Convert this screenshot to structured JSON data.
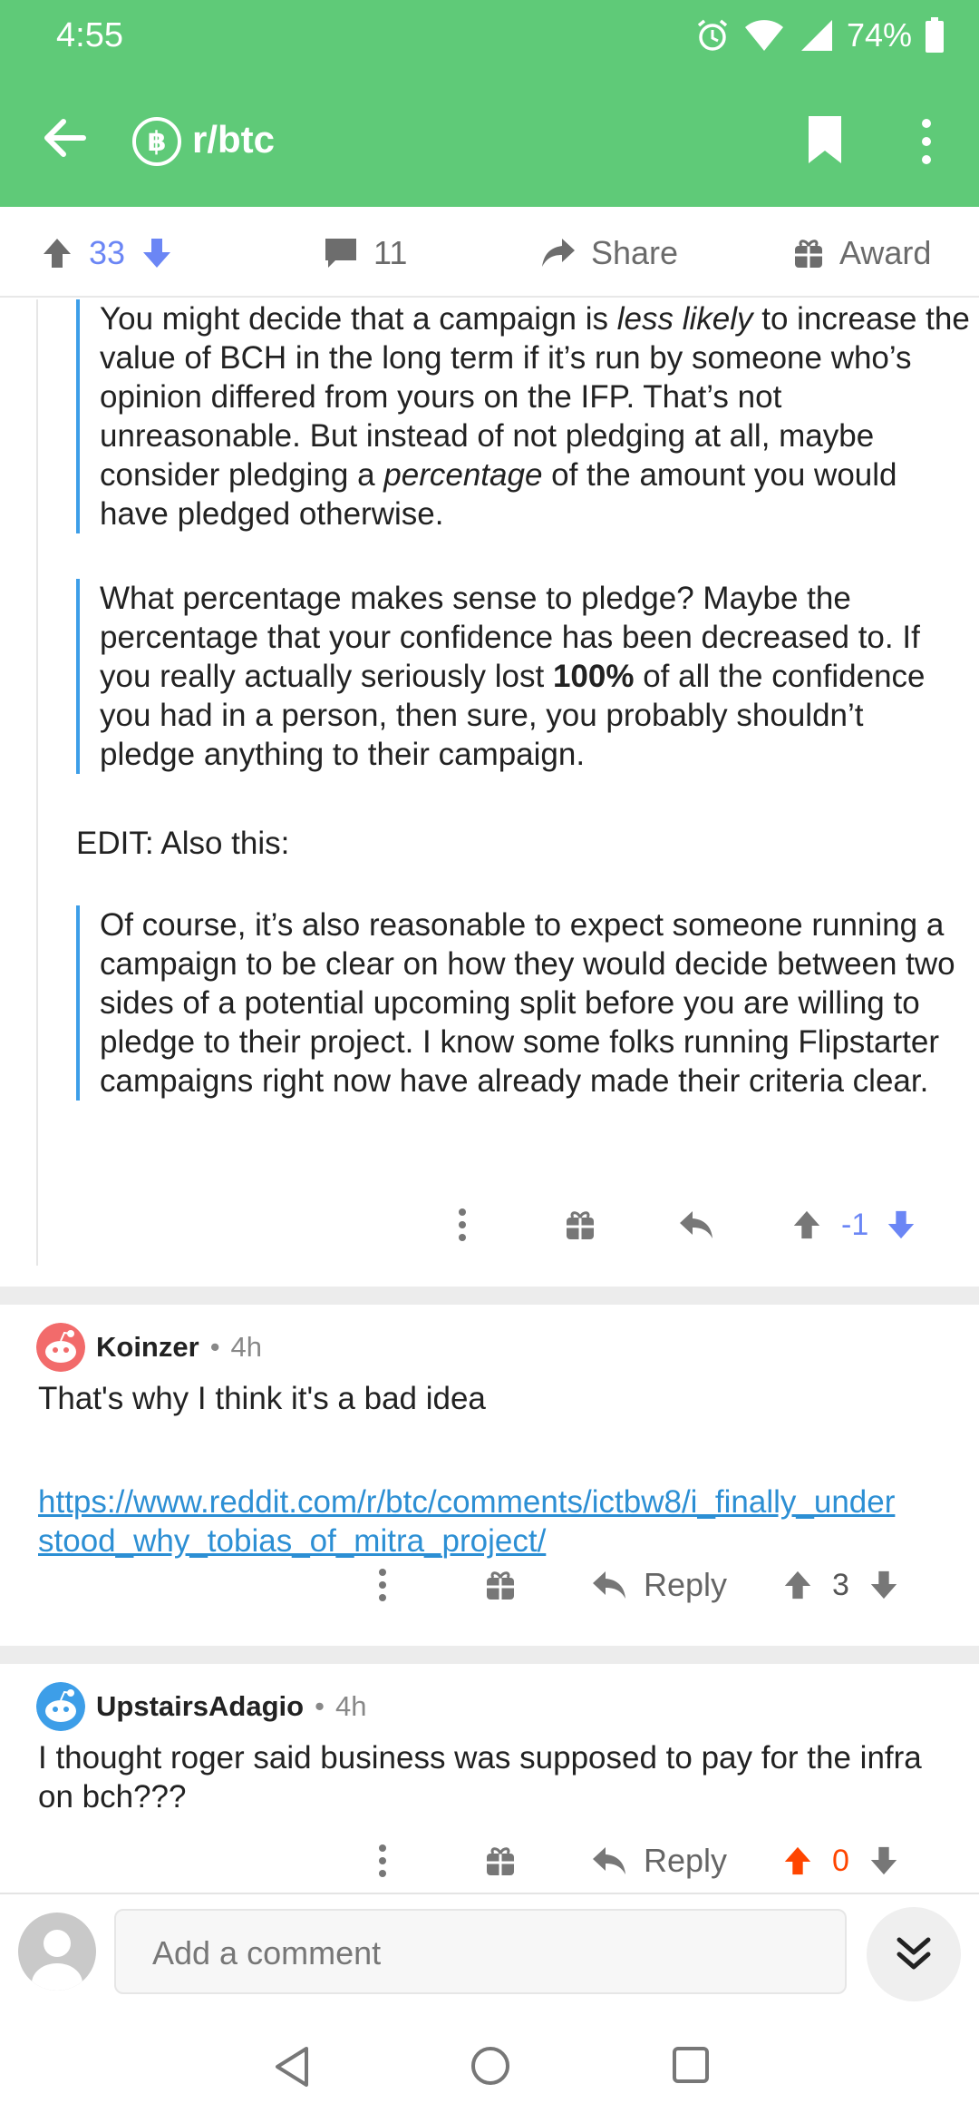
{
  "status_bar": {
    "time": "4:55",
    "battery": "74%"
  },
  "app_bar": {
    "subreddit": "r/btc",
    "sub_icon_letter": "฿"
  },
  "post_actions": {
    "score": "33",
    "comments": "11",
    "share": "Share",
    "award": "Award"
  },
  "nested_comment": {
    "quote1_a": "You might decide that a campaign is ",
    "quote1_em1": "less likely",
    "quote1_b": " to increase the value of BCH in the long term if it’s run by someone who’s opinion differed from yours on the IFP. That’s not unreasonable. But instead of not pledging at all, maybe consider pledging a ",
    "quote1_em2": "percentage",
    "quote1_c": " of the amount you would have pledged otherwise.",
    "quote2_a": "What percentage makes sense to pledge? Maybe the percentage that your confidence has been decreased to. If you really actually seriously lost ",
    "quote2_bold": "100%",
    "quote2_b": " of all the confidence you had in a person, then sure, you probably shouldn’t pledge anything to their campaign.",
    "edit_line": "EDIT: Also this:",
    "quote3": "Of course, it’s also reasonable to expect someone running a campaign to be clear on how they would decide between two sides of a potential upcoming split before you are willing to pledge to their project. I know some folks running Flipstarter campaigns right now have already made their criteria clear.",
    "score": "-1"
  },
  "comments": [
    {
      "author": "Koinzer",
      "age": "4h",
      "text": "That's why I think it's a bad idea",
      "link": "https://www.reddit.com/r/btc/comments/ictbw8/i_finally_understood_why_tobias_of_mitra_project/",
      "reply": "Reply",
      "score": "3"
    },
    {
      "author": "UpstairsAdagio",
      "age": "4h",
      "text": "I thought roger said business was supposed to pay for the infra on bch???",
      "reply": "Reply",
      "score": "0"
    }
  ],
  "composer": {
    "placeholder": "Add a comment"
  },
  "colors": {
    "brand": "#5fca78",
    "link": "#2c8fd4",
    "quote_bar": "#3d9ee8",
    "downvote": "#6b86f5",
    "upvote_active": "#ff4500"
  },
  "icons": [
    "back-arrow-icon",
    "bitcoin-icon",
    "bookmark-icon",
    "more-vert-icon",
    "upvote-icon",
    "downvote-icon",
    "comment-icon",
    "share-icon",
    "gift-icon",
    "reply-icon",
    "chevron-double-down-icon"
  ]
}
